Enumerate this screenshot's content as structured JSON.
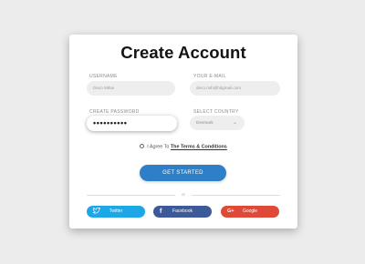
{
  "form": {
    "title": "Create Account",
    "username_label": "USERNAME",
    "username_value": "Deco Mihai",
    "email_label": "YOUR E-MAIL",
    "email_value": "deco.mih@hitgmail.com",
    "password_label": "CREATE PASSWORD",
    "password_value": "••••••••••",
    "country_label": "SELECT COUNTRY",
    "country_value": "Denmark",
    "agree_prefix": "I Agree To",
    "agree_link": "The Terms & Conditions",
    "submit_label": "GET STARTED",
    "or_label": "or"
  },
  "social": {
    "twitter_label": "Twitter",
    "facebook_label": "Facebook",
    "google_label": "Google",
    "google_icon_text": "G+",
    "twitter_color": "#1da7e7",
    "facebook_color": "#3c5a9a",
    "google_color": "#df4a38"
  },
  "colors": {
    "primary": "#2d80c7",
    "background": "#ececec"
  }
}
